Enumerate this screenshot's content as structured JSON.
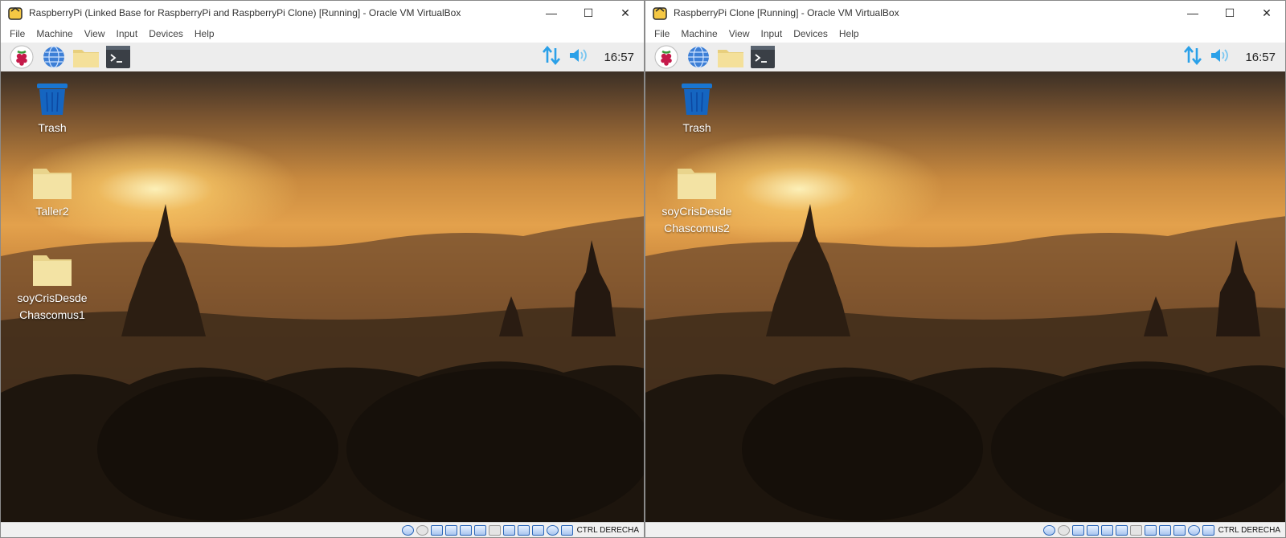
{
  "windows": [
    {
      "id": "left",
      "title": "RaspberryPi (Linked Base for RaspberryPi and RaspberryPi Clone) [Running] - Oracle VM VirtualBox",
      "menu": [
        "File",
        "Machine",
        "View",
        "Input",
        "Devices",
        "Help"
      ],
      "clock": "16:57",
      "desktop_icons": [
        {
          "label": "Trash",
          "icon": "trash-icon"
        },
        {
          "label": "Taller2",
          "icon": "folder-icon"
        },
        {
          "label_line1": "soyCrisDesde",
          "label_line2": "Chascomus1",
          "icon": "folder-icon"
        }
      ],
      "host_key": "CTRL DERECHA"
    },
    {
      "id": "right",
      "title": "RaspberryPi Clone [Running] - Oracle VM VirtualBox",
      "menu": [
        "File",
        "Machine",
        "View",
        "Input",
        "Devices",
        "Help"
      ],
      "clock": "16:57",
      "desktop_icons": [
        {
          "label": "Trash",
          "icon": "trash-icon"
        },
        {
          "label_line1": "soyCrisDesde",
          "label_line2": "Chascomus2",
          "icon": "folder-icon"
        }
      ],
      "host_key": "CTRL DERECHA"
    }
  ],
  "window_controls": {
    "minimize": "—",
    "maximize": "☐",
    "close": "✕"
  },
  "colors": {
    "accent_network": "#2aa0e8",
    "panel_bg": "#ededed",
    "folder": "#f3e3a4",
    "trash": "#1565c0"
  }
}
